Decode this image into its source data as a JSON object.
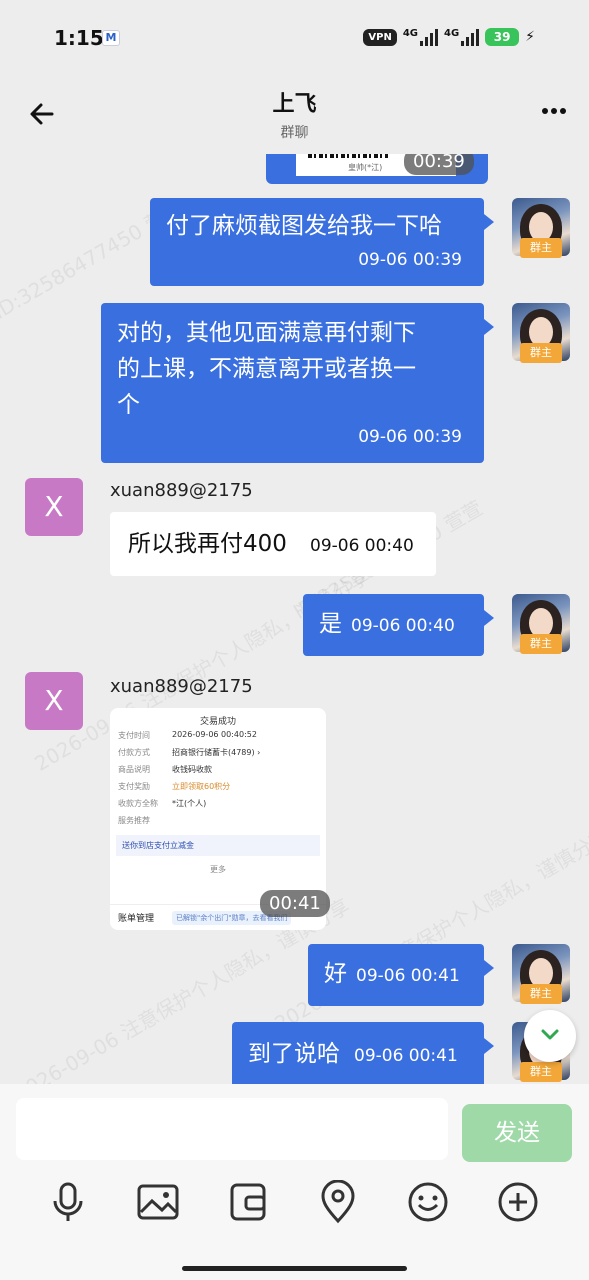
{
  "status_bar": {
    "time": "1:15",
    "mail_icon": "M",
    "vpn": "VPN",
    "signal1": "4G",
    "signal2": "4G",
    "battery": "39",
    "charging_icon": "bolt-icon"
  },
  "header": {
    "title": "上飞",
    "subtitle": "群聊",
    "back_icon": "arrow-left-icon",
    "more_icon": "more-dots-icon"
  },
  "chat": {
    "group_tag": "群主",
    "top_video_time": "00:39",
    "messages": [
      {
        "side": "right",
        "text": "付了麻烦截图发给我一下哈",
        "time": "09-06 00:39"
      },
      {
        "side": "right",
        "text_line1": "对的，其他见面满意再付剩下",
        "text_line2": "的上课，不满意离开或者换一",
        "text_line3": "个",
        "time": "09-06 00:39"
      },
      {
        "side": "left",
        "sender": "xuan889@2175",
        "avatar": "X",
        "text": "所以我再付400",
        "time": "09-06 00:40"
      },
      {
        "side": "right",
        "text": "是",
        "time": "09-06 00:40"
      },
      {
        "side": "left",
        "sender": "xuan889@2175",
        "avatar": "X",
        "type": "video",
        "video_time": "00:41"
      },
      {
        "side": "right",
        "text": "好",
        "time": "09-06 00:41"
      },
      {
        "side": "right",
        "text": "到了说哈",
        "time": "09-06 00:41"
      }
    ],
    "receipt": {
      "title": "交易成功",
      "rows": [
        {
          "k": "支付时间",
          "v": "2026-09-06 00:40:52"
        },
        {
          "k": "付款方式",
          "v": "招商银行储蓄卡(4789) ›"
        },
        {
          "k": "商品说明",
          "v": "收钱码收款"
        },
        {
          "k": "支付奖励",
          "v": "立即领取60积分"
        },
        {
          "k": "收款方全称",
          "v": "*江(个人)"
        },
        {
          "k": "服务推荐",
          "v": ""
        }
      ],
      "promo": "送你到店支付立减金",
      "more": "更多",
      "mgmt_label": "账单管理",
      "mgmt_hint": "已解锁\"余个出门\"勋章，去看看我们"
    },
    "watermark_1": "2026-09-06 注意保护个人隐私，谨慎分享",
    "watermark_2": "ID:32586477450 萱萱"
  },
  "input_bar": {
    "placeholder": "",
    "send_label": "发送",
    "tools": [
      "microphone-icon",
      "image-icon",
      "wallet-icon",
      "location-icon",
      "emoji-icon",
      "plus-icon"
    ]
  }
}
